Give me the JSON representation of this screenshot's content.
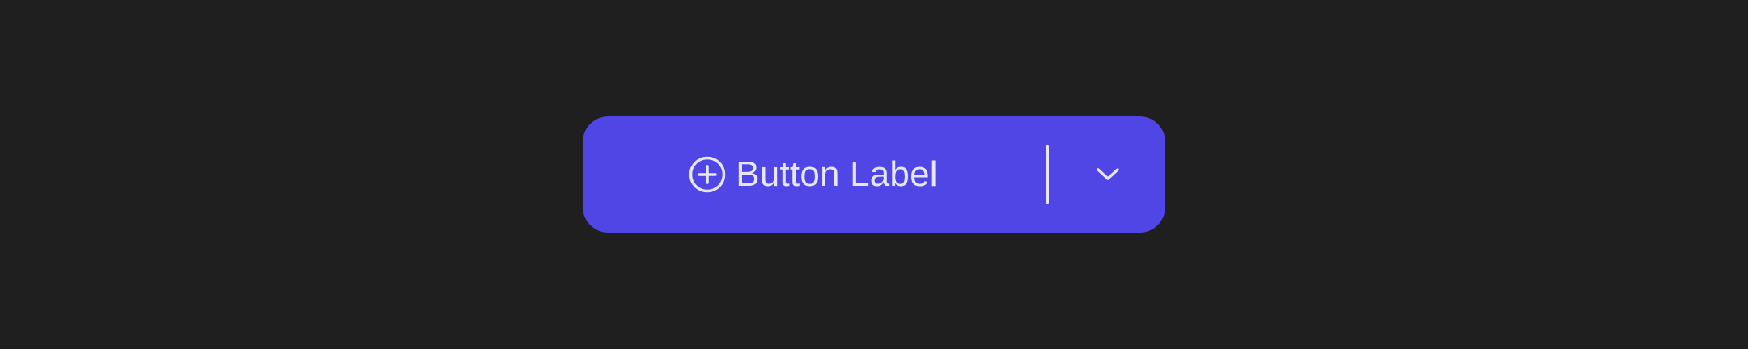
{
  "button": {
    "label": "Button Label",
    "leading_icon": "plus-circle-icon",
    "dropdown_icon": "chevron-down-icon"
  },
  "colors": {
    "background": "#1f1f1f",
    "button_fill": "#5046e5",
    "foreground": "#e6e6f6"
  }
}
